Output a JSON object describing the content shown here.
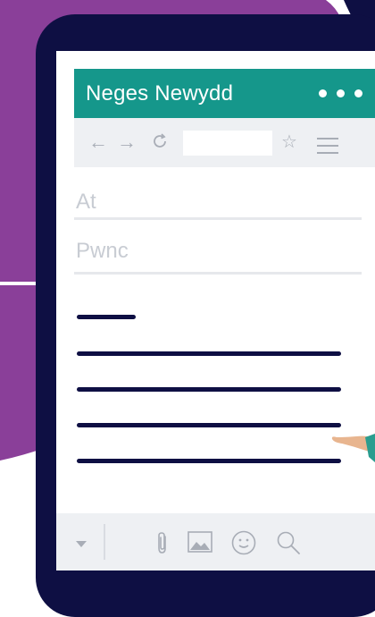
{
  "app": {
    "title": "Neges Newydd"
  },
  "form": {
    "to_placeholder": "At",
    "subject_placeholder": "Pwnc"
  },
  "icons": {
    "header_menu": "more-dots-icon",
    "back": "arrow-left-icon",
    "forward": "arrow-right-icon",
    "reload": "reload-icon",
    "bookmark": "star-icon",
    "menu": "hamburger-menu-icon",
    "dropdown": "caret-down-icon",
    "attach": "paperclip-icon",
    "image": "image-icon",
    "emoji": "smiley-icon",
    "search": "search-icon"
  },
  "colors": {
    "background_purple": "#8a3f99",
    "phone_frame": "#0e0f43",
    "header_teal": "#15978b",
    "toolbar_gray": "#eef0f3",
    "icon_gray": "#a8adb6",
    "hand_skin": "#e8b58f",
    "sleeve_teal": "#2a9d8f"
  }
}
